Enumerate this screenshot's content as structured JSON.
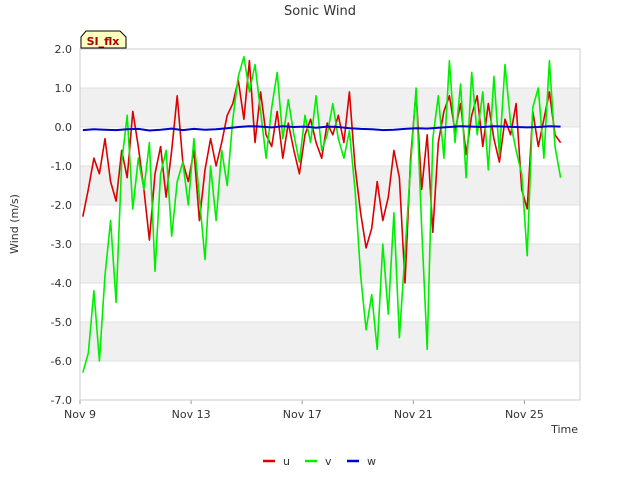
{
  "chart_data": {
    "type": "line",
    "title": "Sonic Wind",
    "xlabel": "Time",
    "ylabel": "Wind (m/s)",
    "badge": "SI_flx",
    "ylim": [
      -7.0,
      2.0
    ],
    "yticks": [
      "2.0",
      "1.0",
      "0.0",
      "-1.0",
      "-2.0",
      "-3.0",
      "-4.0",
      "-5.0",
      "-6.0",
      "-7.0"
    ],
    "yticks_values": [
      2,
      1,
      0,
      -1,
      -2,
      -3,
      -4,
      -5,
      -6,
      -7
    ],
    "xlim_days": [
      "Nov 9",
      "Nov 27"
    ],
    "xticks": [
      "Nov 9",
      "Nov 13",
      "Nov 17",
      "Nov 21",
      "Nov 25"
    ],
    "xticks_values": [
      9,
      13,
      17,
      21,
      25
    ],
    "x_range": [
      9.0,
      27.0
    ],
    "grid": true,
    "legend_position": "bottom-center",
    "colors": {
      "u": "#dd0000",
      "v": "#00ee00",
      "w": "#0000cc",
      "band": "#f0f0f0",
      "badge_bg": "#ffffc0"
    },
    "series": [
      {
        "name": "u",
        "x": [
          9.1,
          9.3,
          9.5,
          9.7,
          9.9,
          10.1,
          10.3,
          10.5,
          10.7,
          10.9,
          11.1,
          11.3,
          11.5,
          11.7,
          11.9,
          12.1,
          12.3,
          12.5,
          12.7,
          12.9,
          13.1,
          13.3,
          13.5,
          13.7,
          13.9,
          14.1,
          14.3,
          14.5,
          14.7,
          14.9,
          15.1,
          15.3,
          15.5,
          15.7,
          15.9,
          16.1,
          16.3,
          16.5,
          16.7,
          16.9,
          17.1,
          17.3,
          17.5,
          17.7,
          17.9,
          18.1,
          18.3,
          18.5,
          18.7,
          18.9,
          19.1,
          19.3,
          19.5,
          19.7,
          19.9,
          20.1,
          20.3,
          20.5,
          20.7,
          20.9,
          21.1,
          21.3,
          21.5,
          21.7,
          21.9,
          22.1,
          22.3,
          22.5,
          22.7,
          22.9,
          23.1,
          23.3,
          23.5,
          23.7,
          23.9,
          24.1,
          24.3,
          24.5,
          24.7,
          24.9,
          25.1,
          25.3,
          25.5,
          25.7,
          25.9,
          26.1,
          26.3
        ],
        "values": [
          -2.3,
          -1.6,
          -0.8,
          -1.2,
          -0.3,
          -1.4,
          -1.9,
          -0.6,
          -1.3,
          0.4,
          -0.5,
          -1.6,
          -2.9,
          -1.2,
          -0.5,
          -1.8,
          -0.6,
          0.8,
          -0.9,
          -1.4,
          -0.6,
          -2.4,
          -1.1,
          -0.3,
          -1.0,
          -0.4,
          0.3,
          0.6,
          1.2,
          0.2,
          1.7,
          -0.4,
          0.9,
          -0.2,
          -0.5,
          0.4,
          -0.8,
          0.1,
          -0.6,
          -1.2,
          -0.2,
          0.2,
          -0.4,
          -0.8,
          0.1,
          -0.2,
          0.3,
          -0.4,
          0.9,
          -1.0,
          -2.2,
          -3.1,
          -2.6,
          -1.4,
          -2.4,
          -1.8,
          -0.6,
          -1.3,
          -4.0,
          -0.8,
          0.9,
          -1.6,
          -0.2,
          -2.7,
          -0.4,
          0.4,
          0.8,
          -0.1,
          0.6,
          -0.7,
          0.3,
          0.8,
          -0.5,
          0.6,
          -0.3,
          -0.9,
          0.2,
          -0.2,
          0.6,
          -1.6,
          -2.1,
          0.4,
          -0.5,
          0.2,
          0.9,
          -0.2,
          -0.4
        ]
      },
      {
        "name": "v",
        "x": [
          9.1,
          9.3,
          9.5,
          9.7,
          9.9,
          10.1,
          10.3,
          10.5,
          10.7,
          10.9,
          11.1,
          11.3,
          11.5,
          11.7,
          11.9,
          12.1,
          12.3,
          12.5,
          12.7,
          12.9,
          13.1,
          13.3,
          13.5,
          13.7,
          13.9,
          14.1,
          14.3,
          14.5,
          14.7,
          14.9,
          15.1,
          15.3,
          15.5,
          15.7,
          15.9,
          16.1,
          16.3,
          16.5,
          16.7,
          16.9,
          17.1,
          17.3,
          17.5,
          17.7,
          17.9,
          18.1,
          18.3,
          18.5,
          18.7,
          18.9,
          19.1,
          19.3,
          19.5,
          19.7,
          19.9,
          20.1,
          20.3,
          20.5,
          20.7,
          20.9,
          21.1,
          21.3,
          21.5,
          21.7,
          21.9,
          22.1,
          22.3,
          22.5,
          22.7,
          22.9,
          23.1,
          23.3,
          23.5,
          23.7,
          23.9,
          24.1,
          24.3,
          24.5,
          24.7,
          24.9,
          25.1,
          25.3,
          25.5,
          25.7,
          25.9,
          26.1,
          26.3
        ],
        "values": [
          -6.3,
          -5.8,
          -4.2,
          -6.0,
          -3.8,
          -2.4,
          -4.5,
          -0.9,
          0.3,
          -2.1,
          -0.8,
          -1.6,
          -0.4,
          -3.7,
          -1.2,
          -0.6,
          -2.8,
          -1.4,
          -0.9,
          -2.0,
          -0.3,
          -1.8,
          -3.4,
          -1.0,
          -2.4,
          -0.6,
          -1.5,
          0.2,
          1.3,
          1.8,
          0.9,
          1.6,
          0.4,
          -0.8,
          0.5,
          1.4,
          -0.3,
          0.7,
          -0.2,
          -0.9,
          0.3,
          -0.4,
          0.8,
          -0.6,
          -0.2,
          0.6,
          -0.3,
          -0.8,
          -0.1,
          -1.6,
          -3.8,
          -5.2,
          -4.3,
          -5.7,
          -3.0,
          -4.8,
          -2.2,
          -5.4,
          -3.2,
          -1.0,
          1.0,
          -2.6,
          -5.7,
          -0.3,
          0.8,
          -0.8,
          1.7,
          -0.4,
          1.1,
          -1.3,
          1.4,
          -0.2,
          0.9,
          -1.1,
          1.3,
          -0.7,
          1.6,
          0.1,
          -0.6,
          -1.2,
          -3.3,
          0.5,
          1.0,
          -0.8,
          1.7,
          -0.5,
          -1.3
        ]
      },
      {
        "name": "w",
        "x": [
          9.1,
          9.5,
          9.9,
          10.3,
          10.7,
          11.1,
          11.5,
          11.9,
          12.3,
          12.7,
          13.1,
          13.5,
          13.9,
          14.3,
          14.7,
          15.1,
          15.5,
          15.9,
          16.3,
          16.7,
          17.1,
          17.5,
          17.9,
          18.3,
          18.7,
          19.1,
          19.5,
          19.9,
          20.3,
          20.7,
          21.1,
          21.5,
          21.9,
          22.3,
          22.7,
          23.1,
          23.5,
          23.9,
          24.3,
          24.7,
          25.1,
          25.5,
          25.9,
          26.3
        ],
        "values": [
          -0.08,
          -0.06,
          -0.07,
          -0.08,
          -0.06,
          -0.05,
          -0.09,
          -0.07,
          -0.04,
          -0.08,
          -0.05,
          -0.07,
          -0.06,
          -0.03,
          0.0,
          0.02,
          0.01,
          -0.01,
          0.02,
          0.0,
          0.01,
          -0.02,
          0.01,
          0.0,
          -0.03,
          -0.05,
          -0.06,
          -0.08,
          -0.07,
          -0.05,
          -0.03,
          -0.04,
          -0.02,
          0.0,
          0.02,
          0.01,
          0.0,
          0.02,
          0.01,
          0.0,
          -0.01,
          0.0,
          0.02,
          0.01
        ]
      }
    ]
  }
}
